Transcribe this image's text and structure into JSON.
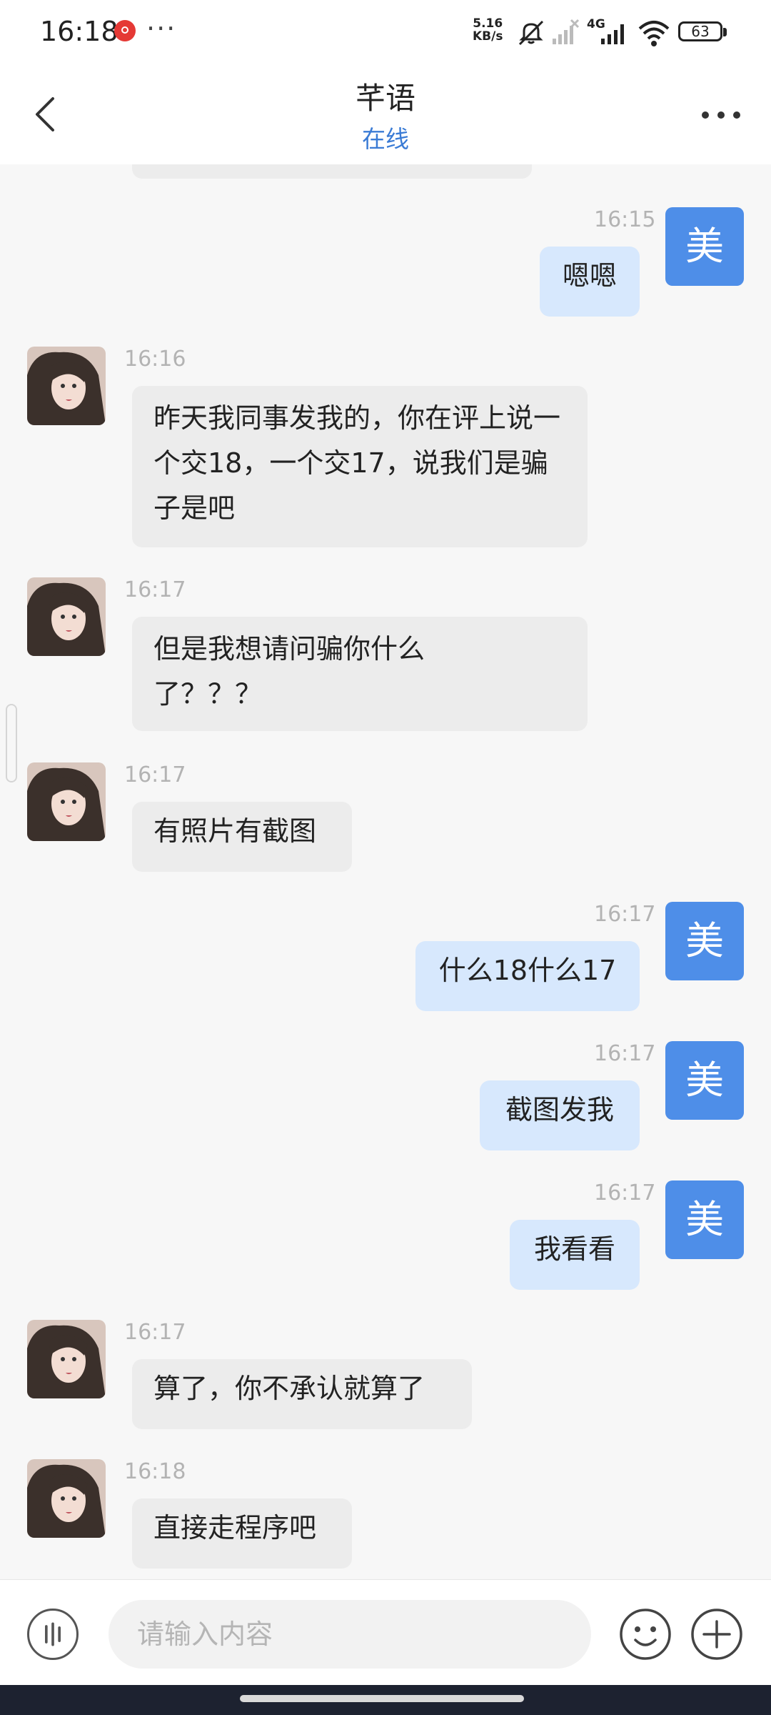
{
  "status_bar": {
    "time": "16:18",
    "more": "···",
    "speed": "5.16\nKB/s",
    "speed_top": "5.16",
    "speed_bottom": "KB/s",
    "network": "4G",
    "battery": "63"
  },
  "header": {
    "title": "芊语",
    "status": "在线"
  },
  "my_avatar_char": "美",
  "messages": [
    {
      "side": "out",
      "time": "16:15",
      "text": "嗯嗯"
    },
    {
      "side": "in",
      "time": "16:16",
      "text": "昨天我同事发我的，你在评上说一个交18，一个交17，说我们是骗子是吧"
    },
    {
      "side": "in",
      "time": "16:17",
      "text": "但是我想请问骗你什么了？？？"
    },
    {
      "side": "in",
      "time": "16:17",
      "text": "有照片有截图"
    },
    {
      "side": "out",
      "time": "16:17",
      "text": "什么18什么17"
    },
    {
      "side": "out",
      "time": "16:17",
      "text": "截图发我"
    },
    {
      "side": "out",
      "time": "16:17",
      "text": "我看看"
    },
    {
      "side": "in",
      "time": "16:17",
      "text": "算了，你不承认就算了"
    },
    {
      "side": "in",
      "time": "16:18",
      "text": "直接走程序吧"
    }
  ],
  "input": {
    "placeholder": "请输入内容"
  },
  "icons": {
    "back": "chevron-left-icon",
    "more": "more-horizontal-icon",
    "voice": "voice-icon",
    "emoji": "emoji-icon",
    "plus": "plus-icon"
  }
}
